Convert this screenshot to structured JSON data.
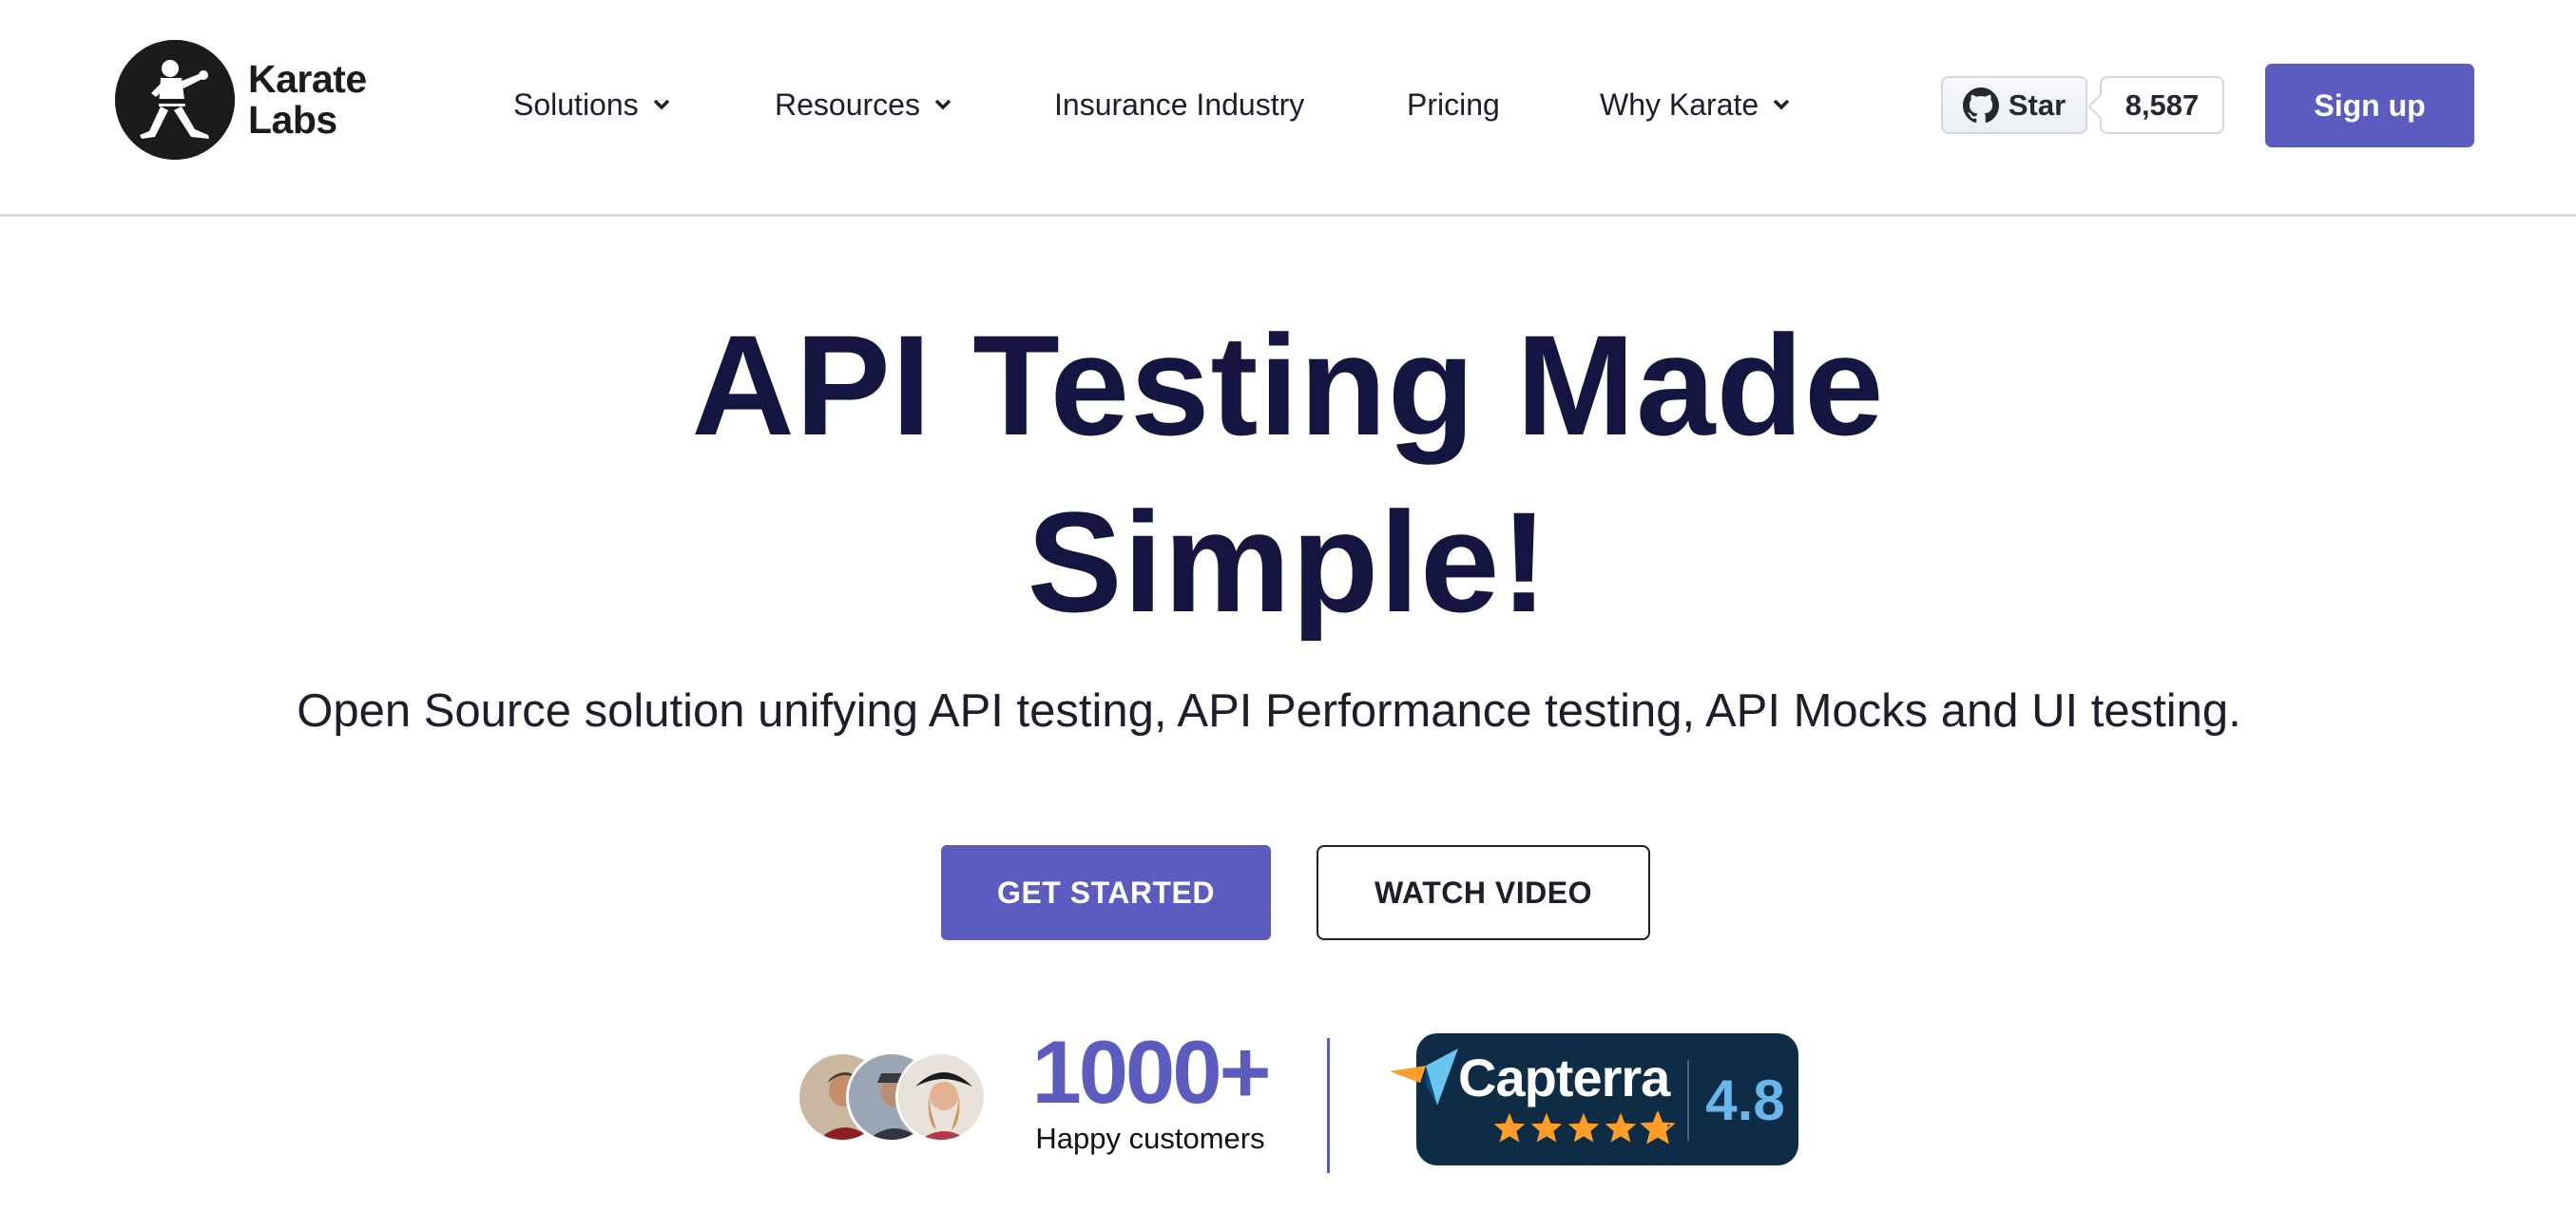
{
  "brand": {
    "name_line1": "Karate",
    "name_line2": "Labs"
  },
  "nav": [
    {
      "label": "Solutions",
      "has_dropdown": true
    },
    {
      "label": "Resources",
      "has_dropdown": true
    },
    {
      "label": "Insurance Industry",
      "has_dropdown": false
    },
    {
      "label": "Pricing",
      "has_dropdown": false
    },
    {
      "label": "Why Karate",
      "has_dropdown": true
    }
  ],
  "github": {
    "star_label": "Star",
    "star_count": "8,587"
  },
  "header_cta": {
    "label": "Sign up"
  },
  "hero": {
    "title_line1": "API Testing Made",
    "title_line2": "Simple!",
    "subtitle": "Open Source solution unifying API testing, API Performance testing, API Mocks and UI testing.",
    "primary_button": "GET STARTED",
    "secondary_button": "WATCH VIDEO"
  },
  "social_proof": {
    "customer_count": "1000+",
    "customer_label": "Happy customers",
    "capterra": {
      "wordmark": "Capterra",
      "rating": "4.8",
      "stars": 4.8
    }
  },
  "colors": {
    "accent": "#5b5bc0",
    "heading": "#141540",
    "capterra_bg": "#0f2c47",
    "capterra_rating": "#69b6ec",
    "star": "#ff9d28"
  }
}
